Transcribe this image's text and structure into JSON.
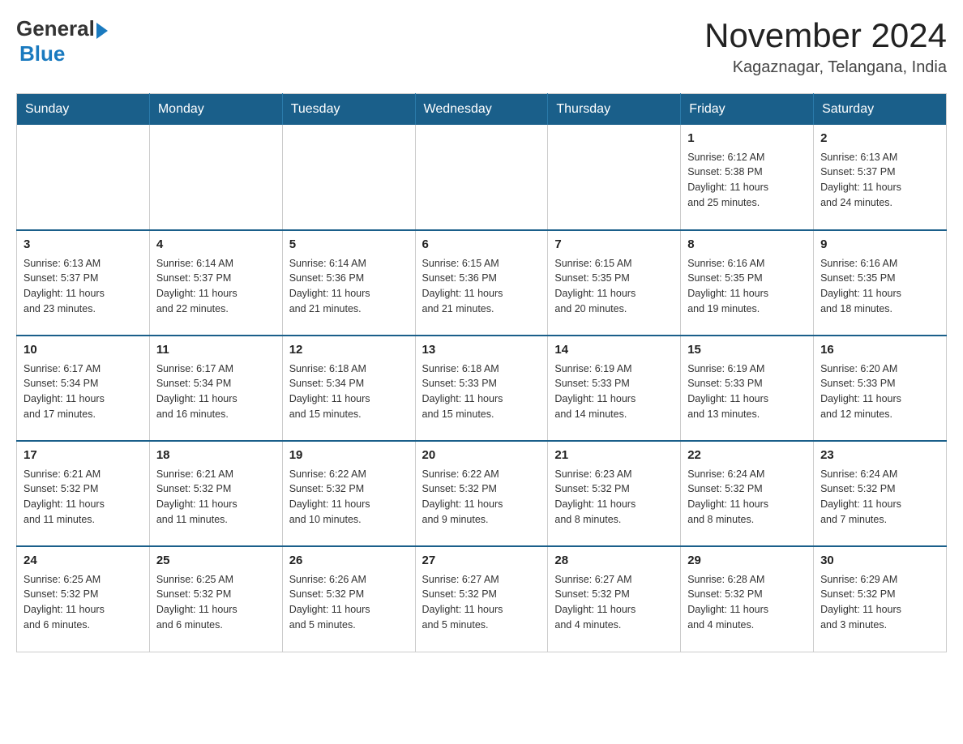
{
  "logo": {
    "general": "General",
    "blue": "Blue"
  },
  "title": "November 2024",
  "location": "Kagaznagar, Telangana, India",
  "days": [
    "Sunday",
    "Monday",
    "Tuesday",
    "Wednesday",
    "Thursday",
    "Friday",
    "Saturday"
  ],
  "weeks": [
    [
      {
        "day": "",
        "info": ""
      },
      {
        "day": "",
        "info": ""
      },
      {
        "day": "",
        "info": ""
      },
      {
        "day": "",
        "info": ""
      },
      {
        "day": "",
        "info": ""
      },
      {
        "day": "1",
        "info": "Sunrise: 6:12 AM\nSunset: 5:38 PM\nDaylight: 11 hours\nand 25 minutes."
      },
      {
        "day": "2",
        "info": "Sunrise: 6:13 AM\nSunset: 5:37 PM\nDaylight: 11 hours\nand 24 minutes."
      }
    ],
    [
      {
        "day": "3",
        "info": "Sunrise: 6:13 AM\nSunset: 5:37 PM\nDaylight: 11 hours\nand 23 minutes."
      },
      {
        "day": "4",
        "info": "Sunrise: 6:14 AM\nSunset: 5:37 PM\nDaylight: 11 hours\nand 22 minutes."
      },
      {
        "day": "5",
        "info": "Sunrise: 6:14 AM\nSunset: 5:36 PM\nDaylight: 11 hours\nand 21 minutes."
      },
      {
        "day": "6",
        "info": "Sunrise: 6:15 AM\nSunset: 5:36 PM\nDaylight: 11 hours\nand 21 minutes."
      },
      {
        "day": "7",
        "info": "Sunrise: 6:15 AM\nSunset: 5:35 PM\nDaylight: 11 hours\nand 20 minutes."
      },
      {
        "day": "8",
        "info": "Sunrise: 6:16 AM\nSunset: 5:35 PM\nDaylight: 11 hours\nand 19 minutes."
      },
      {
        "day": "9",
        "info": "Sunrise: 6:16 AM\nSunset: 5:35 PM\nDaylight: 11 hours\nand 18 minutes."
      }
    ],
    [
      {
        "day": "10",
        "info": "Sunrise: 6:17 AM\nSunset: 5:34 PM\nDaylight: 11 hours\nand 17 minutes."
      },
      {
        "day": "11",
        "info": "Sunrise: 6:17 AM\nSunset: 5:34 PM\nDaylight: 11 hours\nand 16 minutes."
      },
      {
        "day": "12",
        "info": "Sunrise: 6:18 AM\nSunset: 5:34 PM\nDaylight: 11 hours\nand 15 minutes."
      },
      {
        "day": "13",
        "info": "Sunrise: 6:18 AM\nSunset: 5:33 PM\nDaylight: 11 hours\nand 15 minutes."
      },
      {
        "day": "14",
        "info": "Sunrise: 6:19 AM\nSunset: 5:33 PM\nDaylight: 11 hours\nand 14 minutes."
      },
      {
        "day": "15",
        "info": "Sunrise: 6:19 AM\nSunset: 5:33 PM\nDaylight: 11 hours\nand 13 minutes."
      },
      {
        "day": "16",
        "info": "Sunrise: 6:20 AM\nSunset: 5:33 PM\nDaylight: 11 hours\nand 12 minutes."
      }
    ],
    [
      {
        "day": "17",
        "info": "Sunrise: 6:21 AM\nSunset: 5:32 PM\nDaylight: 11 hours\nand 11 minutes."
      },
      {
        "day": "18",
        "info": "Sunrise: 6:21 AM\nSunset: 5:32 PM\nDaylight: 11 hours\nand 11 minutes."
      },
      {
        "day": "19",
        "info": "Sunrise: 6:22 AM\nSunset: 5:32 PM\nDaylight: 11 hours\nand 10 minutes."
      },
      {
        "day": "20",
        "info": "Sunrise: 6:22 AM\nSunset: 5:32 PM\nDaylight: 11 hours\nand 9 minutes."
      },
      {
        "day": "21",
        "info": "Sunrise: 6:23 AM\nSunset: 5:32 PM\nDaylight: 11 hours\nand 8 minutes."
      },
      {
        "day": "22",
        "info": "Sunrise: 6:24 AM\nSunset: 5:32 PM\nDaylight: 11 hours\nand 8 minutes."
      },
      {
        "day": "23",
        "info": "Sunrise: 6:24 AM\nSunset: 5:32 PM\nDaylight: 11 hours\nand 7 minutes."
      }
    ],
    [
      {
        "day": "24",
        "info": "Sunrise: 6:25 AM\nSunset: 5:32 PM\nDaylight: 11 hours\nand 6 minutes."
      },
      {
        "day": "25",
        "info": "Sunrise: 6:25 AM\nSunset: 5:32 PM\nDaylight: 11 hours\nand 6 minutes."
      },
      {
        "day": "26",
        "info": "Sunrise: 6:26 AM\nSunset: 5:32 PM\nDaylight: 11 hours\nand 5 minutes."
      },
      {
        "day": "27",
        "info": "Sunrise: 6:27 AM\nSunset: 5:32 PM\nDaylight: 11 hours\nand 5 minutes."
      },
      {
        "day": "28",
        "info": "Sunrise: 6:27 AM\nSunset: 5:32 PM\nDaylight: 11 hours\nand 4 minutes."
      },
      {
        "day": "29",
        "info": "Sunrise: 6:28 AM\nSunset: 5:32 PM\nDaylight: 11 hours\nand 4 minutes."
      },
      {
        "day": "30",
        "info": "Sunrise: 6:29 AM\nSunset: 5:32 PM\nDaylight: 11 hours\nand 3 minutes."
      }
    ]
  ]
}
